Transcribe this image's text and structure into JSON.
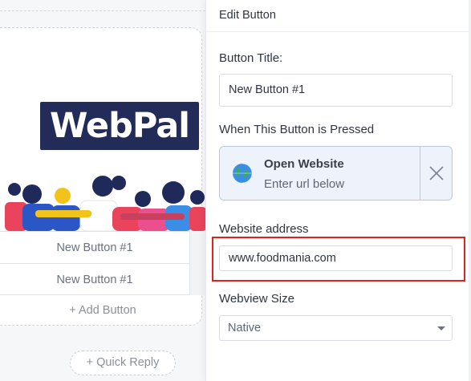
{
  "preview": {
    "logo_text": "WebPal",
    "buttons": [
      {
        "label": "New Button #1"
      },
      {
        "label": "New Button #1"
      }
    ],
    "add_button_label": "+ Add Button",
    "quick_reply_label": "+  Quick Reply"
  },
  "panel": {
    "title": "Edit Button",
    "button_title_label": "Button Title:",
    "button_title_value": "New Button #1",
    "pressed_label": "When This Button is Pressed",
    "action": {
      "icon": "globe-icon",
      "title": "Open Website",
      "subtitle": "Enter url below",
      "close_icon": "close-icon"
    },
    "website_label": "Website address",
    "website_value": "www.foodmania.com",
    "webview_label": "Webview Size",
    "webview_value": "Native",
    "webview_options": [
      "Native"
    ]
  },
  "colors": {
    "logo_bg": "#232c59",
    "highlight": "#e0231f",
    "action_bg": "#eef3fb",
    "action_border": "#b9c9e0"
  }
}
